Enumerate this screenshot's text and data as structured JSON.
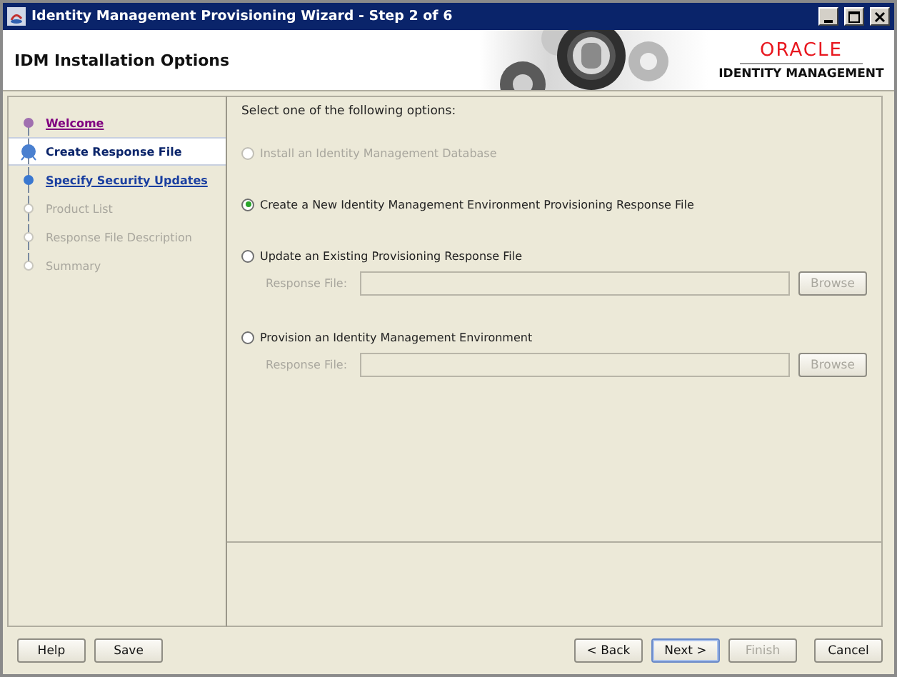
{
  "window": {
    "title": "Identity Management Provisioning Wizard - Step 2 of 6"
  },
  "header": {
    "title": "IDM Installation Options",
    "logo_brand": "ORACLE",
    "logo_product": "IDENTITY MANAGEMENT"
  },
  "steps": [
    {
      "label": "Welcome",
      "kind": "visited",
      "selected": false
    },
    {
      "label": "Create Response File",
      "kind": "current",
      "selected": true
    },
    {
      "label": "Specify Security Updates",
      "kind": "available",
      "selected": false
    },
    {
      "label": "Product List",
      "kind": "disabled",
      "selected": false
    },
    {
      "label": "Response File Description",
      "kind": "disabled",
      "selected": false
    },
    {
      "label": "Summary",
      "kind": "disabled",
      "selected": false
    }
  ],
  "prompt": "Select one of the following options:",
  "options": [
    {
      "label": "Install an Identity Management Database",
      "selected": false,
      "disabled": true
    },
    {
      "label": "Create a New Identity Management Environment Provisioning Response File",
      "selected": true,
      "disabled": false
    },
    {
      "label": "Update an Existing Provisioning Response File",
      "selected": false,
      "disabled": false,
      "file": {
        "label": "Response File:",
        "browse": "Browse",
        "disabled": true
      }
    },
    {
      "label": "Provision an Identity Management Environment",
      "selected": false,
      "disabled": false,
      "file": {
        "label": "Response File:",
        "browse": "Browse",
        "disabled": true
      }
    }
  ],
  "buttons_left": [
    {
      "label": "Help",
      "disabled": false,
      "focused": false
    },
    {
      "label": "Save",
      "disabled": false,
      "focused": false
    }
  ],
  "buttons_right": [
    {
      "label": "< Back",
      "disabled": false,
      "focused": false
    },
    {
      "label": "Next >",
      "disabled": false,
      "focused": true
    },
    {
      "label": "Finish",
      "disabled": true,
      "focused": false
    },
    {
      "label": "Cancel",
      "disabled": false,
      "focused": false
    }
  ]
}
